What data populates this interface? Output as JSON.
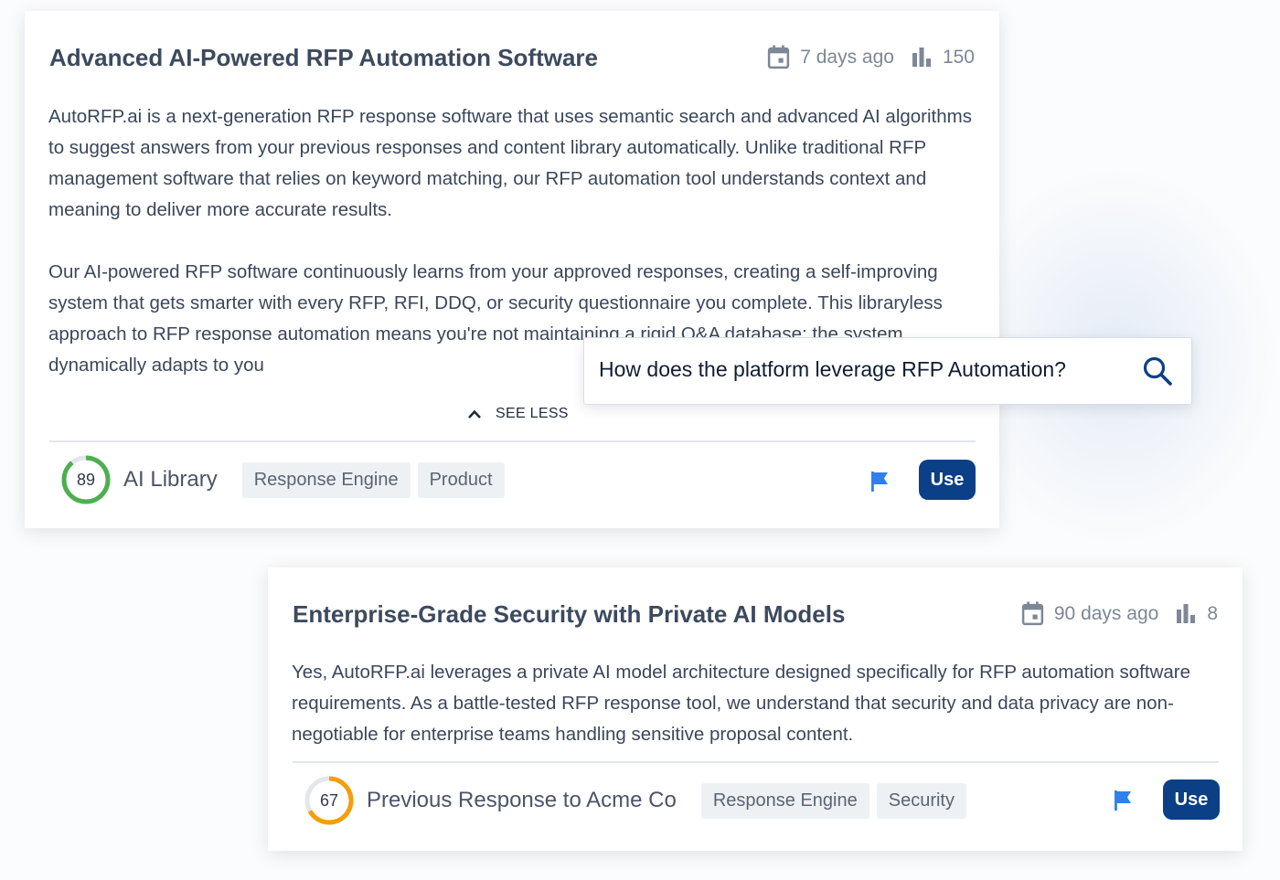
{
  "cards": [
    {
      "title": "Advanced AI-Powered RFP Automation Software",
      "age": "7 days ago",
      "views": "150",
      "paragraphs": [
        "AutoRFP.ai is a next-generation RFP response software that uses semantic search and advanced AI algorithms to suggest answers from your previous responses and content library automatically. Unlike traditional RFP management software that relies on keyword matching, our RFP automation tool understands context and meaning to deliver more accurate results.",
        "Our AI-powered RFP software continuously learns from your approved responses, creating a self-improving system that gets smarter with every RFP, RFI, DDQ, or security questionnaire you complete. This libraryless approach to RFP response automation means you're not maintaining a rigid Q&A database; the system dynamically adapts to you"
      ],
      "toggle_label": "SEE LESS",
      "score": 89,
      "score_label": "89",
      "score_color": "#4caf50",
      "source": "AI Library",
      "tags": [
        "Response Engine",
        "Product"
      ],
      "use_label": "Use"
    },
    {
      "title": "Enterprise-Grade Security with Private AI Models",
      "age": "90 days ago",
      "views": "8",
      "paragraphs": [
        "Yes, AutoRFP.ai leverages a private AI model architecture designed specifically for RFP automation software requirements. As a battle-tested RFP response tool, we understand that security and data privacy are non-negotiable for enterprise teams handling sensitive proposal content."
      ],
      "score": 67,
      "score_label": "67",
      "score_color": "#f59e0b",
      "source": "Previous Response to Acme Co",
      "tags": [
        "Response Engine",
        "Security"
      ],
      "use_label": "Use"
    }
  ],
  "search_popup": {
    "query": "How does the platform leverage RFP Automation?",
    "icon": "search-icon"
  },
  "colors": {
    "primary": "#0b3f86",
    "flag": "#2f80ed",
    "track": "#e3e7ec"
  },
  "icons": {
    "date": "calendar-icon",
    "views": "bar-chart-icon",
    "toggle": "chevron-up-icon",
    "flag": "flag-icon"
  }
}
